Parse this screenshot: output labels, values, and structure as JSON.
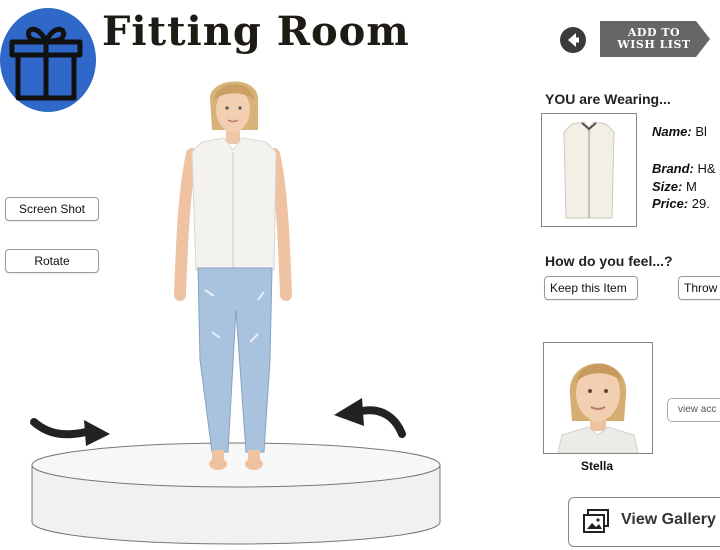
{
  "header": {
    "title": "Fitting Room",
    "logo_icon": "gift-box-icon",
    "brand_color": "#2f68c8"
  },
  "toolbar": {
    "back_icon": "back-arrow-icon",
    "wishlist_label_line1": "ADD TO",
    "wishlist_label_line2": "WISH LIST"
  },
  "left_panel": {
    "screenshot_label": "Screen Shot",
    "rotate_label": "Rotate",
    "rotate_left_icon": "curved-arrow-right-icon",
    "rotate_right_icon": "curved-arrow-left-icon"
  },
  "wearing": {
    "heading": "YOU are Wearing...",
    "name_label": "Name:",
    "name_value": "Bl",
    "brand_label": "Brand:",
    "brand_value": "H&",
    "size_label": "Size:",
    "size_value": "M",
    "price_label": "Price:",
    "price_value": "29."
  },
  "feedback": {
    "heading": "How do you feel...?",
    "keep_label": "Keep this Item",
    "throw_label": "Throw"
  },
  "avatar": {
    "name": "Stella",
    "view_accessories_label": "view acc"
  },
  "gallery": {
    "label": "View Gallery",
    "icon": "photo-stack-icon"
  }
}
